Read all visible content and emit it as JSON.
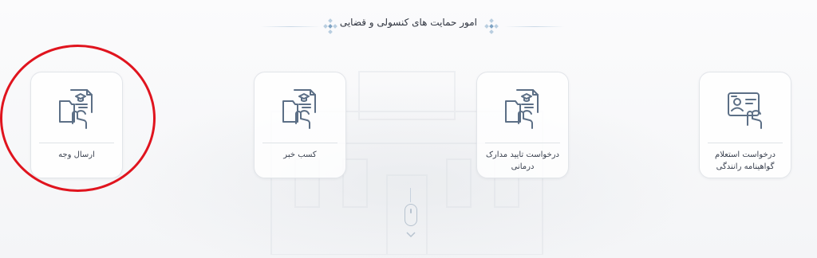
{
  "section": {
    "title": "امور حمایت های کنسولی و قضایی"
  },
  "cards": [
    {
      "label": "ارسال وجه",
      "icon": "document-touch-icon"
    },
    {
      "label": "کسب خبر",
      "icon": "document-touch-icon"
    },
    {
      "label": "درخواست تایید مدارک درمانی",
      "icon": "document-touch-icon"
    },
    {
      "label": "درخواست استعلام گواهینامه رانندگی",
      "icon": "license-card-touch-icon"
    }
  ],
  "colors": {
    "icon_stroke": "#5c6f86",
    "highlight": "#e0141e",
    "card_border": "#e2e5e9"
  },
  "icons": {
    "header_decoration": "diamond-ornament-icon",
    "scroll": "mouse-scroll-icon",
    "scroll_arrow": "chevron-down-icon"
  }
}
